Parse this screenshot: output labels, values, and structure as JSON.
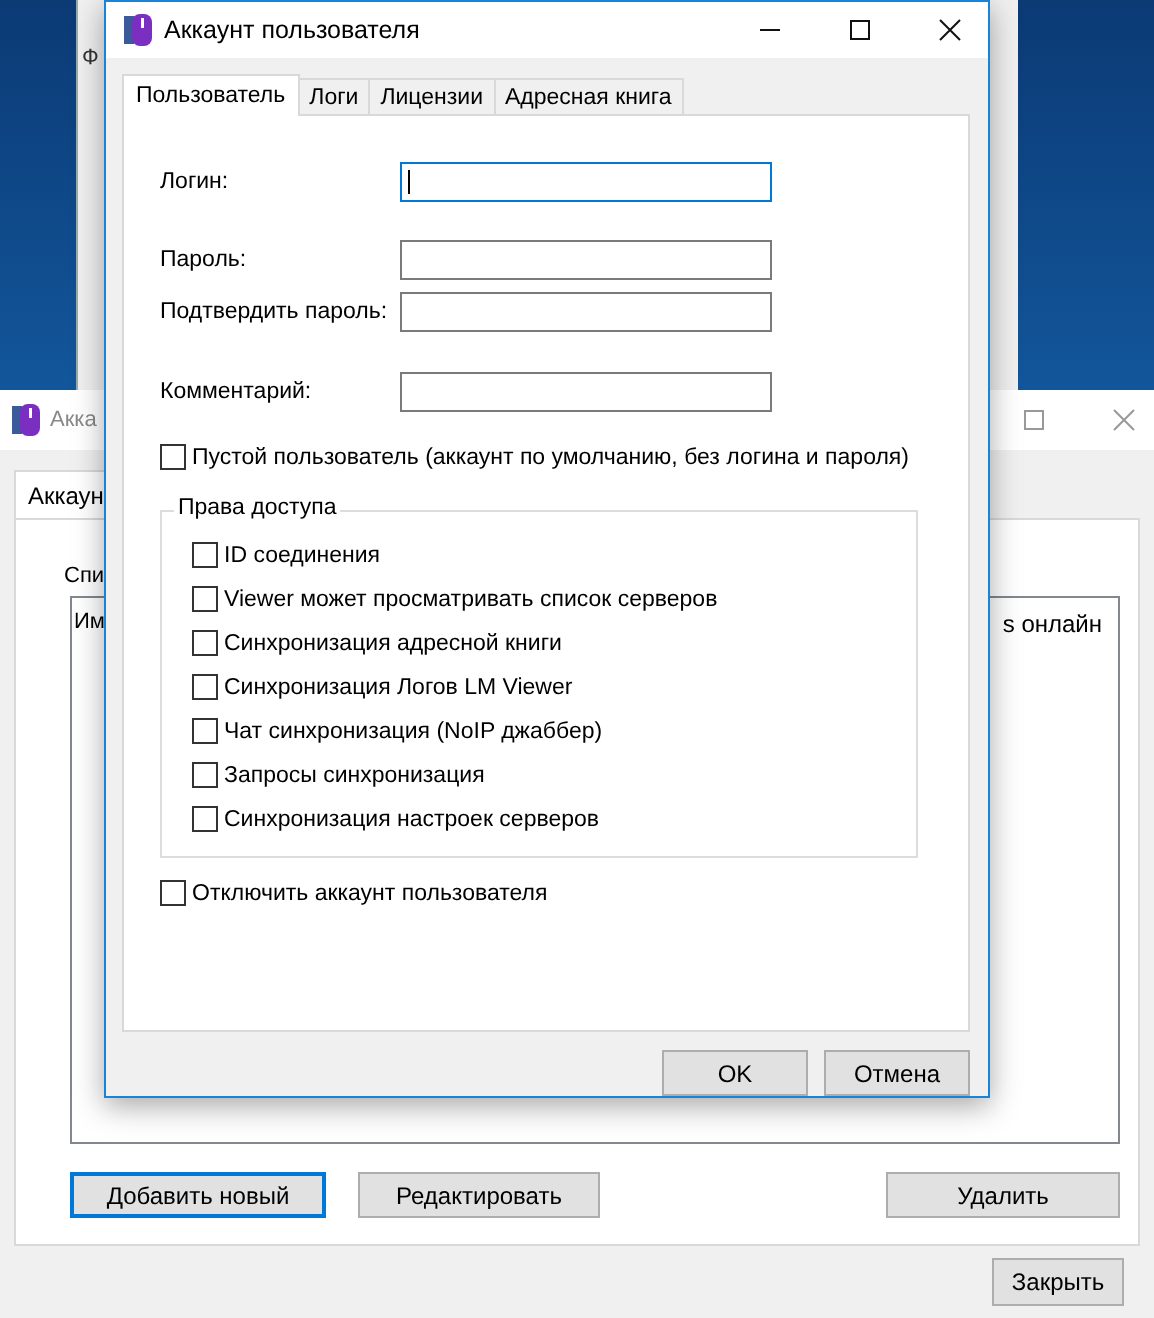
{
  "back_window_top": {
    "menu_text": "Ф"
  },
  "back_window": {
    "title": "Акка",
    "tab": "Аккаун",
    "list_label": "Спи",
    "columns": [
      "Им",
      "s онлайн"
    ],
    "buttons": [
      {
        "label": "Добавить новый",
        "focused": true,
        "kind": "left"
      },
      {
        "label": "Редактировать",
        "focused": false,
        "kind": "left"
      },
      {
        "label": "Удалить",
        "focused": false,
        "kind": "right"
      }
    ],
    "close_button": "Закрыть"
  },
  "dialog": {
    "title": "Аккаунт пользователя",
    "tabs": [
      {
        "label": "Пользователь",
        "selected": true
      },
      {
        "label": "Логи",
        "selected": false
      },
      {
        "label": "Лицензии",
        "selected": false
      },
      {
        "label": "Адресная книга",
        "selected": false
      }
    ],
    "field_groups": [
      [
        {
          "label": "Логин:",
          "focused": true
        }
      ],
      [
        {
          "label": "Пароль:",
          "focused": false
        },
        {
          "label": "Подтвердить пароль:",
          "focused": false
        }
      ],
      [
        {
          "label": "Комментарий:",
          "focused": false
        }
      ]
    ],
    "blank_user": {
      "label": "Пустой пользователь (аккаунт по умолчанию, без логина и пароля)",
      "checked": false
    },
    "permissions": {
      "title": "Права доступа",
      "items": [
        {
          "label": "ID соединения",
          "checked": false
        },
        {
          "label": "Viewer может просматривать список серверов",
          "checked": false
        },
        {
          "label": "Синхронизация адресной книги",
          "checked": false
        },
        {
          "label": "Синхронизация Логов LM Viewer",
          "checked": false
        },
        {
          "label": "Чат синхронизация (NoIP джаббер)",
          "checked": false
        },
        {
          "label": "Запросы синхронизация",
          "checked": false
        },
        {
          "label": "Синхронизация настроек серверов",
          "checked": false
        }
      ]
    },
    "disable_account": {
      "label": "Отключить аккаунт пользователя",
      "checked": false
    },
    "buttons": [
      "OK",
      "Отмена"
    ]
  }
}
